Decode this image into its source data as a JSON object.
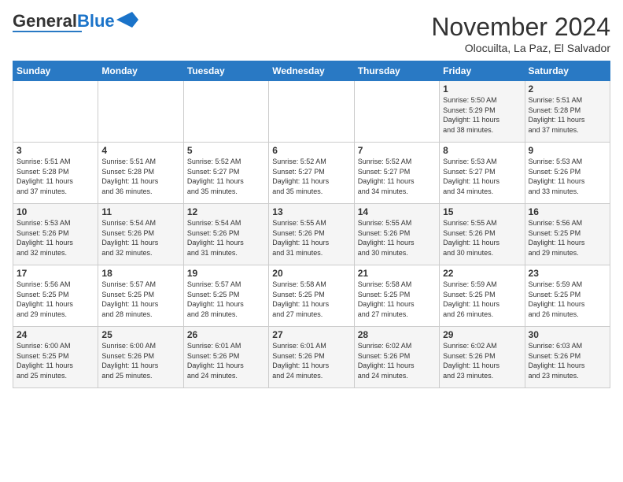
{
  "header": {
    "logo_general": "General",
    "logo_blue": "Blue",
    "title": "November 2024",
    "subtitle": "Olocuilta, La Paz, El Salvador"
  },
  "days_of_week": [
    "Sunday",
    "Monday",
    "Tuesday",
    "Wednesday",
    "Thursday",
    "Friday",
    "Saturday"
  ],
  "weeks": [
    [
      {
        "day": "",
        "info": ""
      },
      {
        "day": "",
        "info": ""
      },
      {
        "day": "",
        "info": ""
      },
      {
        "day": "",
        "info": ""
      },
      {
        "day": "",
        "info": ""
      },
      {
        "day": "1",
        "info": "Sunrise: 5:50 AM\nSunset: 5:29 PM\nDaylight: 11 hours\nand 38 minutes."
      },
      {
        "day": "2",
        "info": "Sunrise: 5:51 AM\nSunset: 5:28 PM\nDaylight: 11 hours\nand 37 minutes."
      }
    ],
    [
      {
        "day": "3",
        "info": "Sunrise: 5:51 AM\nSunset: 5:28 PM\nDaylight: 11 hours\nand 37 minutes."
      },
      {
        "day": "4",
        "info": "Sunrise: 5:51 AM\nSunset: 5:28 PM\nDaylight: 11 hours\nand 36 minutes."
      },
      {
        "day": "5",
        "info": "Sunrise: 5:52 AM\nSunset: 5:27 PM\nDaylight: 11 hours\nand 35 minutes."
      },
      {
        "day": "6",
        "info": "Sunrise: 5:52 AM\nSunset: 5:27 PM\nDaylight: 11 hours\nand 35 minutes."
      },
      {
        "day": "7",
        "info": "Sunrise: 5:52 AM\nSunset: 5:27 PM\nDaylight: 11 hours\nand 34 minutes."
      },
      {
        "day": "8",
        "info": "Sunrise: 5:53 AM\nSunset: 5:27 PM\nDaylight: 11 hours\nand 34 minutes."
      },
      {
        "day": "9",
        "info": "Sunrise: 5:53 AM\nSunset: 5:26 PM\nDaylight: 11 hours\nand 33 minutes."
      }
    ],
    [
      {
        "day": "10",
        "info": "Sunrise: 5:53 AM\nSunset: 5:26 PM\nDaylight: 11 hours\nand 32 minutes."
      },
      {
        "day": "11",
        "info": "Sunrise: 5:54 AM\nSunset: 5:26 PM\nDaylight: 11 hours\nand 32 minutes."
      },
      {
        "day": "12",
        "info": "Sunrise: 5:54 AM\nSunset: 5:26 PM\nDaylight: 11 hours\nand 31 minutes."
      },
      {
        "day": "13",
        "info": "Sunrise: 5:55 AM\nSunset: 5:26 PM\nDaylight: 11 hours\nand 31 minutes."
      },
      {
        "day": "14",
        "info": "Sunrise: 5:55 AM\nSunset: 5:26 PM\nDaylight: 11 hours\nand 30 minutes."
      },
      {
        "day": "15",
        "info": "Sunrise: 5:55 AM\nSunset: 5:26 PM\nDaylight: 11 hours\nand 30 minutes."
      },
      {
        "day": "16",
        "info": "Sunrise: 5:56 AM\nSunset: 5:25 PM\nDaylight: 11 hours\nand 29 minutes."
      }
    ],
    [
      {
        "day": "17",
        "info": "Sunrise: 5:56 AM\nSunset: 5:25 PM\nDaylight: 11 hours\nand 29 minutes."
      },
      {
        "day": "18",
        "info": "Sunrise: 5:57 AM\nSunset: 5:25 PM\nDaylight: 11 hours\nand 28 minutes."
      },
      {
        "day": "19",
        "info": "Sunrise: 5:57 AM\nSunset: 5:25 PM\nDaylight: 11 hours\nand 28 minutes."
      },
      {
        "day": "20",
        "info": "Sunrise: 5:58 AM\nSunset: 5:25 PM\nDaylight: 11 hours\nand 27 minutes."
      },
      {
        "day": "21",
        "info": "Sunrise: 5:58 AM\nSunset: 5:25 PM\nDaylight: 11 hours\nand 27 minutes."
      },
      {
        "day": "22",
        "info": "Sunrise: 5:59 AM\nSunset: 5:25 PM\nDaylight: 11 hours\nand 26 minutes."
      },
      {
        "day": "23",
        "info": "Sunrise: 5:59 AM\nSunset: 5:25 PM\nDaylight: 11 hours\nand 26 minutes."
      }
    ],
    [
      {
        "day": "24",
        "info": "Sunrise: 6:00 AM\nSunset: 5:25 PM\nDaylight: 11 hours\nand 25 minutes."
      },
      {
        "day": "25",
        "info": "Sunrise: 6:00 AM\nSunset: 5:26 PM\nDaylight: 11 hours\nand 25 minutes."
      },
      {
        "day": "26",
        "info": "Sunrise: 6:01 AM\nSunset: 5:26 PM\nDaylight: 11 hours\nand 24 minutes."
      },
      {
        "day": "27",
        "info": "Sunrise: 6:01 AM\nSunset: 5:26 PM\nDaylight: 11 hours\nand 24 minutes."
      },
      {
        "day": "28",
        "info": "Sunrise: 6:02 AM\nSunset: 5:26 PM\nDaylight: 11 hours\nand 24 minutes."
      },
      {
        "day": "29",
        "info": "Sunrise: 6:02 AM\nSunset: 5:26 PM\nDaylight: 11 hours\nand 23 minutes."
      },
      {
        "day": "30",
        "info": "Sunrise: 6:03 AM\nSunset: 5:26 PM\nDaylight: 11 hours\nand 23 minutes."
      }
    ]
  ]
}
